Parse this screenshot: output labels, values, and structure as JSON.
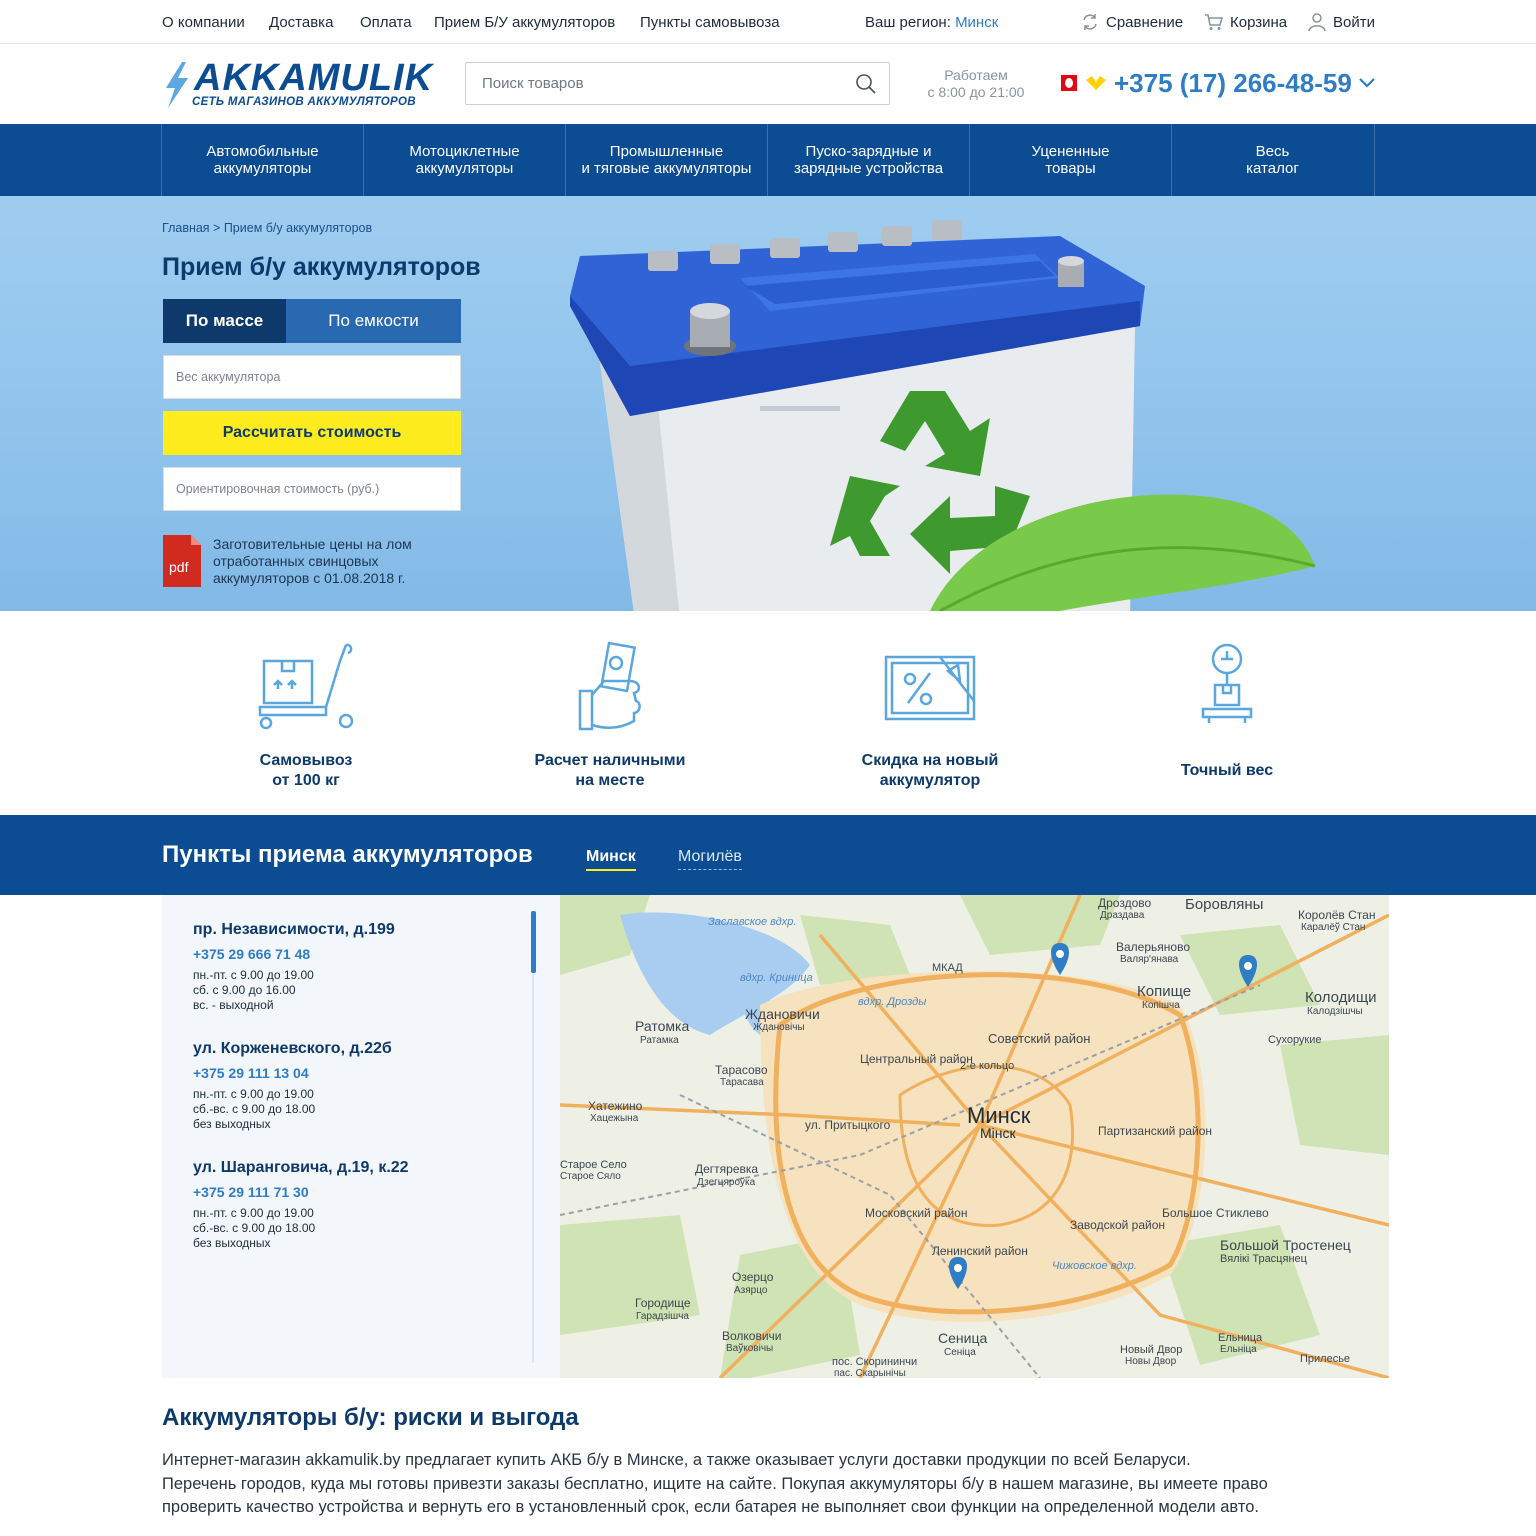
{
  "topbar": {
    "links": [
      "О компании",
      "Доставка",
      "Оплата",
      "Прием Б/У аккумуляторов",
      "Пункты самовывоза"
    ],
    "region_label": "Ваш регион:",
    "region_city": "Минск",
    "compare": "Сравнение",
    "cart": "Корзина",
    "login": "Войти"
  },
  "header": {
    "brand": "AKKAMULIK",
    "tagline": "СЕТЬ МАГАЗИНОВ АККУМУЛЯТОРОВ",
    "search_placeholder": "Поиск товаров",
    "hours_line1": "Работаем",
    "hours_line2": "с 8:00 до 21:00",
    "phone": "+375 (17) 266-48-59"
  },
  "nav": [
    "Автомобильные\nаккумуляторы",
    "Мотоциклетные\nаккумуляторы",
    "Промышленные\nи тяговые аккумуляторы",
    "Пуско-зарядные и\nзарядные устройства",
    "Уцененные\nтовары",
    "Весь\nкаталог"
  ],
  "hero": {
    "breadcrumb": "Главная > Прием б/у аккумуляторов",
    "title": "Прием б/у аккумуляторов",
    "tab_mass": "По массе",
    "tab_capacity": "По емкости",
    "weight_placeholder": "Вес аккумулятора",
    "calc_button": "Рассчитать стоимость",
    "price_placeholder": "Ориентировочная стоимость (руб.)",
    "pdf_label": "pdf",
    "pdf_text": "Заготовительные цены на лом отработанных свинцовых аккумуляторов с 01.08.2018 г."
  },
  "features": [
    {
      "icon": "pallet-truck-icon",
      "text": "Самовывоз\nот 100 кг"
    },
    {
      "icon": "cash-hand-icon",
      "text": "Расчет наличными\nна месте"
    },
    {
      "icon": "discount-coupon-icon",
      "text": "Скидка на новый\nаккумулятор"
    },
    {
      "icon": "scale-icon",
      "text": "Точный вес"
    }
  ],
  "pickup": {
    "title": "Пункты приема аккумуляторов",
    "tab_minsk": "Минск",
    "tab_mogilev": "Могилёв"
  },
  "addresses": [
    {
      "street": "пр. Независимости, д.199",
      "phone": "+375 29 666 71 48",
      "hours": "пн.-пт. с 9.00 до 19.00\nсб. с 9.00 до 16.00\nвс. - выходной"
    },
    {
      "street": "ул. Корженевского, д.22б",
      "phone": "+375 29 111 13 04",
      "hours": "пн.-пт. с 9.00 до 19.00\nсб.-вс. с 9.00 до 18.00\nбез выходных"
    },
    {
      "street": "ул. Шаранговича, д.19, к.22",
      "phone": "+375 29 111 71 30",
      "hours": "пн.-пт. с 9.00 до 19.00\nсб.-вс. с 9.00 до 18.00\nбез выходных"
    }
  ],
  "map": {
    "city": "Минск",
    "city_by": "Мінск",
    "labels": [
      "Заславское вдхр.",
      "вдхр. Криница",
      "Ждановичи",
      "Ждановічы",
      "Ратомка",
      "Ратамка",
      "вдхр. Дрозды",
      "Дроздово",
      "Драздава",
      "Боровляны",
      "Валерьяново",
      "Валяр'янава",
      "Копище",
      "Копішча",
      "Королёв Стан",
      "Каралёў Стан",
      "Колодищи",
      "Калодзішчы",
      "Сухорукие",
      "Советский район",
      "Центральный район",
      "2-е кольцо",
      "Тарасово",
      "Тарасава",
      "Хатежино",
      "Хацежына",
      "ул. Притыцкого",
      "Партизанский район",
      "Дегтяревка",
      "Дзегцяроўка",
      "Московский район",
      "Заводской район",
      "Ленинский район",
      "Чижовское вдхр.",
      "Большое Стиклево",
      "Большой Тростенец",
      "Вялікі Трасцянец",
      "Озерцо",
      "Азярцо",
      "Городище",
      "Гарадзішча",
      "Волковичи",
      "Ваўковічы",
      "Сеница",
      "Сеніца",
      "пос. Скорининчи",
      "пас. Скарынічы",
      "Новый Двор",
      "Новы Двор",
      "Ельница",
      "Ельніца",
      "Прилесье",
      "МКАД",
      "Старое Село",
      "Старое Сяло"
    ]
  },
  "article": {
    "title": "Аккумуляторы б/у: риски и выгода",
    "line1": "Интернет-магазин akkamulik.by предлагает купить АКБ б/у в Минске, а также оказывает услуги доставки продукции по всей Беларуси.",
    "line2": "Перечень городов, куда мы готовы привезти заказы бесплатно, ищите на сайте. Покупая аккумуляторы б/у в нашем магазине, вы имеете право",
    "line3": "проверить качество устройства и вернуть его в установленный срок, если батарея не выполняет свои функции на определенной модели авто."
  },
  "colors": {
    "brand_blue": "#0b4c92",
    "link_blue": "#2f7dc4",
    "accent_yellow": "#ffec1f",
    "pdf_red": "#d12a1e"
  }
}
